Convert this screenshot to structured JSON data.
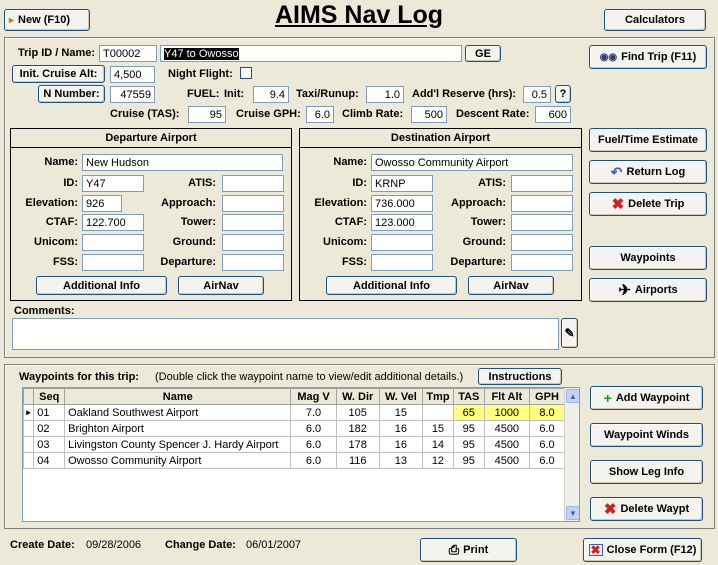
{
  "title": "AIMS Nav Log",
  "toolbar": {
    "new_label": "New  (F10)",
    "calculators_label": "Calculators"
  },
  "trip": {
    "id_label": "Trip ID / Name:",
    "id_value": "T00002",
    "name_value": "Y47 to Owosso",
    "ge_label": "GE",
    "cruise_alt_label": "Init. Cruise Alt:",
    "cruise_alt_value": "4,500",
    "night_label": "Night Flight:",
    "n_number_label": "N Number:",
    "n_number_value": "47559",
    "fuel_label": "FUEL:",
    "init_label": "Init:",
    "init_value": "9.4",
    "taxi_label": "Taxi/Runup:",
    "taxi_value": "1.0",
    "reserve_label": "Add'l Reserve (hrs):",
    "reserve_value": "0.5",
    "help_label": "?",
    "tas_label": "Cruise (TAS):",
    "tas_value": "95",
    "gph_label": "Cruise GPH:",
    "gph_value": "6.0",
    "climb_label": "Climb Rate:",
    "climb_value": "500",
    "descent_label": "Descent Rate:",
    "descent_value": "600"
  },
  "departure": {
    "title": "Departure Airport",
    "name_label": "Name:",
    "name": "New Hudson",
    "id_label": "ID:",
    "id": "Y47",
    "atis_label": "ATIS:",
    "atis": "",
    "elevation_label": "Elevation:",
    "elevation": "926",
    "approach_label": "Approach:",
    "approach": "",
    "ctaf_label": "CTAF:",
    "ctaf": "122.700",
    "tower_label": "Tower:",
    "tower": "",
    "unicom_label": "Unicom:",
    "unicom": "",
    "ground_label": "Ground:",
    "ground": "",
    "fss_label": "FSS:",
    "fss": "",
    "departure_label": "Departure:",
    "departure_freq": "",
    "additional_label": "Additional Info",
    "airnav_label": "AirNav"
  },
  "destination": {
    "title": "Destination Airport",
    "name_label": "Name:",
    "name": "Owosso Community Airport",
    "id_label": "ID:",
    "id": "KRNP",
    "atis_label": "ATIS:",
    "atis": "",
    "elevation_label": "Elevation:",
    "elevation": "736.000",
    "approach_label": "Approach:",
    "approach": "",
    "ctaf_label": "CTAF:",
    "ctaf": "123.000",
    "tower_label": "Tower:",
    "tower": "",
    "unicom_label": "Unicom:",
    "unicom": "",
    "ground_label": "Ground:",
    "ground": "",
    "fss_label": "FSS:",
    "fss": "",
    "departure_label": "Departure:",
    "departure_freq": "",
    "additional_label": "Additional Info",
    "airnav_label": "AirNav"
  },
  "side": {
    "find_trip": "Find Trip (F11)",
    "fuel_time": "Fuel/Time Estimate",
    "return_log": "Return Log",
    "delete_trip": "Delete Trip",
    "waypoints": "Waypoints",
    "airports": "Airports"
  },
  "comments": {
    "label": "Comments:",
    "value": ""
  },
  "waypoints": {
    "title": "Waypoints for this trip:",
    "hint": "(Double click the waypoint name to view/edit additional details.)",
    "instructions_label": "Instructions",
    "columns": [
      "Seq",
      "Name",
      "Mag V",
      "W. Dir",
      "W. Vel",
      "Tmp",
      "TAS",
      "Flt Alt",
      "GPH"
    ],
    "rows": [
      {
        "seq": "01",
        "name": "Oakland Southwest Airport",
        "magv": "7.0",
        "wdir": "105",
        "wvel": "15",
        "tmp": "",
        "tas": "65",
        "alt": "1000",
        "gph": "8.0"
      },
      {
        "seq": "02",
        "name": "Brighton Airport",
        "magv": "6.0",
        "wdir": "182",
        "wvel": "16",
        "tmp": "15",
        "tas": "95",
        "alt": "4500",
        "gph": "6.0"
      },
      {
        "seq": "03",
        "name": "Livingston County Spencer J. Hardy Airport",
        "magv": "6.0",
        "wdir": "178",
        "wvel": "16",
        "tmp": "14",
        "tas": "95",
        "alt": "4500",
        "gph": "6.0"
      },
      {
        "seq": "04",
        "name": "Owosso Community Airport",
        "magv": "6.0",
        "wdir": "116",
        "wvel": "13",
        "tmp": "12",
        "tas": "95",
        "alt": "4500",
        "gph": "6.0"
      }
    ],
    "add_waypoint": "Add Waypoint",
    "waypoint_winds": "Waypoint Winds",
    "show_leg_info": "Show Leg Info",
    "delete_waypt": "Delete Waypt"
  },
  "footer": {
    "create_label": "Create Date:",
    "create_value": "09/28/2006",
    "change_label": "Change Date:",
    "change_value": "06/01/2007",
    "print_label": "Print",
    "close_label": "Close Form (F12)"
  },
  "colors": {
    "highlight": "#FFFF80",
    "delete_icon": "#D02020",
    "add_icon": "#1A9A1A"
  }
}
